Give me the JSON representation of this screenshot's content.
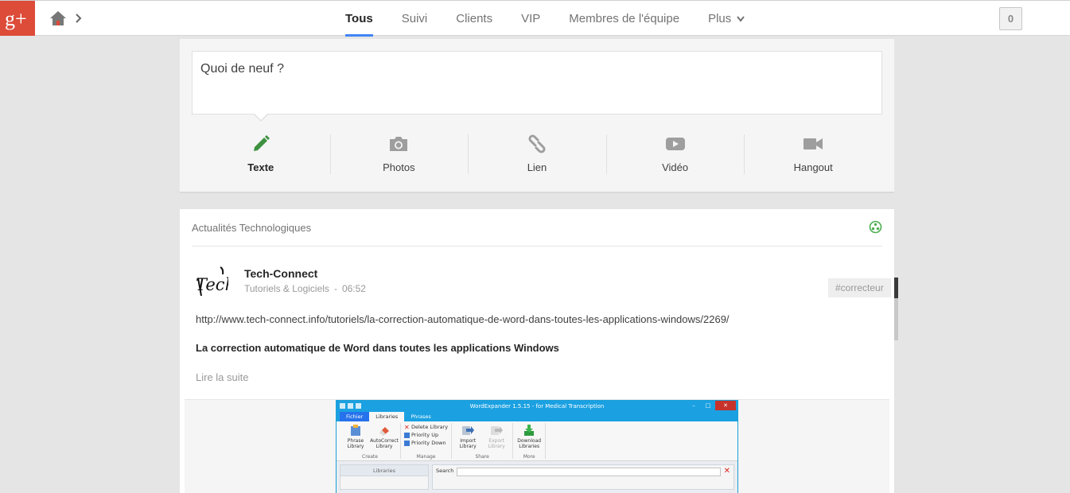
{
  "topbar": {
    "logo_label": "g+",
    "tabs": [
      {
        "label": "Tous",
        "active": true
      },
      {
        "label": "Suivi"
      },
      {
        "label": "Clients"
      },
      {
        "label": "VIP"
      },
      {
        "label": "Membres de l'équipe"
      },
      {
        "label": "Plus"
      }
    ],
    "notification_count": "0"
  },
  "sharebox": {
    "placeholder": "Quoi de neuf ?",
    "actions": [
      {
        "label": "Texte",
        "icon": "pencil-icon",
        "color": "#3d9140",
        "selected": true
      },
      {
        "label": "Photos",
        "icon": "camera-icon",
        "color": "#9e9e9e"
      },
      {
        "label": "Lien",
        "icon": "link-icon",
        "color": "#9e9e9e"
      },
      {
        "label": "Vidéo",
        "icon": "video-play-icon",
        "color": "#9e9e9e"
      },
      {
        "label": "Hangout",
        "icon": "video-camera-icon",
        "color": "#9e9e9e"
      }
    ]
  },
  "post": {
    "collection_title": "Actualités Technologiques",
    "author": "Tech-Connect",
    "category": "Tutoriels & Logiciels",
    "separator": "-",
    "time": "06:52",
    "hashtag": "#correcteur",
    "link": "http://www.tech-connect.info/tutoriels/la-correction-automatique-de-word-dans-toutes-les-applications-windows/2269/",
    "headline": "La correction automatique de Word dans toutes les applications Windows",
    "read_more": "Lire la suite",
    "accent_color": "#4caf50"
  },
  "embedded_screenshot": {
    "window_title": "WordExpander 1.5.15 - for Medical Transcription",
    "ribbon_tabs": [
      "Fichier",
      "Libraries",
      "Phrases"
    ],
    "groups": {
      "create": {
        "name": "Create",
        "buttons": [
          "Phrase Library",
          "AutoCorrect Library"
        ]
      },
      "manage": {
        "name": "Manage",
        "items": [
          "Delete Library",
          "Priority Up",
          "Priority Down"
        ]
      },
      "share": {
        "name": "Share",
        "buttons": [
          "Import Library",
          "Export Library"
        ]
      },
      "more": {
        "name": "More",
        "buttons": [
          "Download Libraries"
        ]
      }
    },
    "left_pane_title": "Libraries",
    "search_label": "Search"
  },
  "colors": {
    "brand_red": "#dd4b39",
    "tab_underline": "#4285f4",
    "background": "#e5e5e5"
  }
}
